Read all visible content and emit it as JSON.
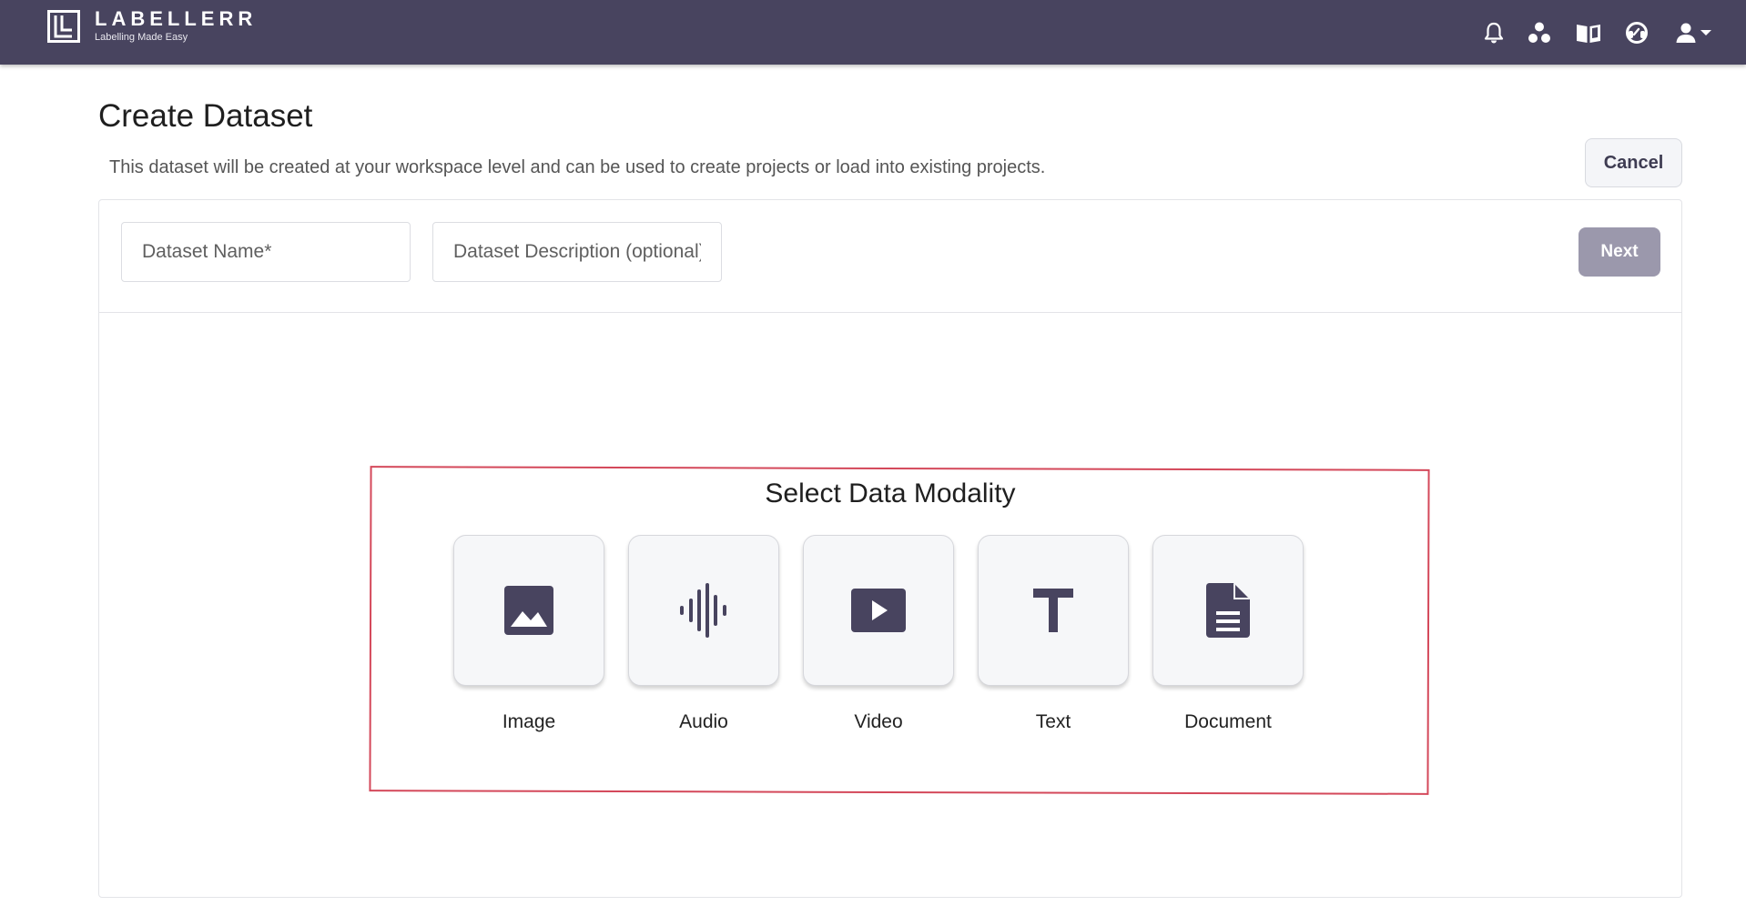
{
  "brand": {
    "name": "LABELLERR",
    "tagline": "Labelling Made Easy"
  },
  "topbar_icons": [
    "bell-icon",
    "team-icon",
    "book-icon",
    "support-icon",
    "user-icon",
    "caret-down-icon"
  ],
  "colors": {
    "topbar": "#48445f",
    "accent": "#48445f",
    "next_disabled": "#9b98ac",
    "highlight_border": "#d4485a"
  },
  "page": {
    "title": "Create Dataset",
    "subtitle": "This dataset will be created at your workspace level and can be used to create projects or load into existing projects.",
    "cancel_label": "Cancel"
  },
  "form": {
    "name_placeholder": "Dataset Name*",
    "description_placeholder": "Dataset Description (optional)",
    "next_label": "Next"
  },
  "modality": {
    "title": "Select Data Modality",
    "options": [
      {
        "label": "Image",
        "icon": "image-icon"
      },
      {
        "label": "Audio",
        "icon": "audio-waveform-icon"
      },
      {
        "label": "Video",
        "icon": "video-play-icon"
      },
      {
        "label": "Text",
        "icon": "text-t-icon"
      },
      {
        "label": "Document",
        "icon": "document-icon"
      }
    ]
  }
}
